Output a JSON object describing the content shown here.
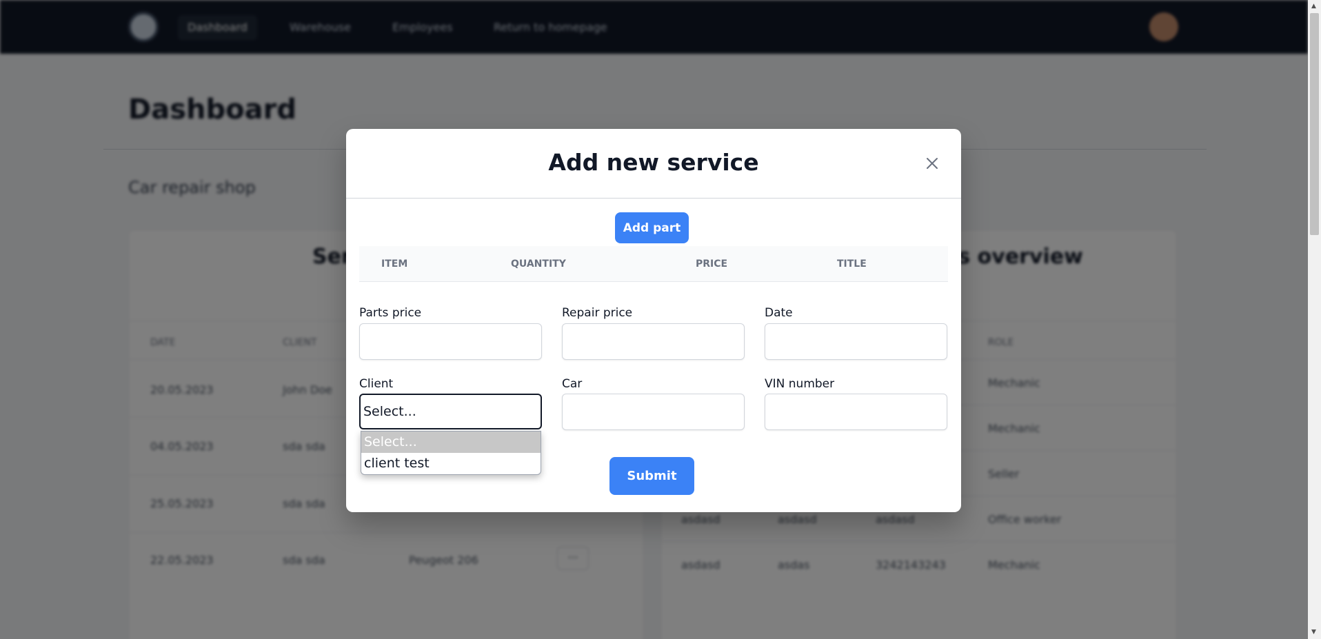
{
  "navbar": {
    "links": [
      "Dashboard",
      "Warehouse",
      "Employees",
      "Return to homepage"
    ]
  },
  "page": {
    "title": "Dashboard",
    "subtitle": "Car repair shop"
  },
  "services_card": {
    "heading": "Services",
    "columns": [
      "DATE",
      "CLIENT"
    ],
    "rows": [
      {
        "date": "20.05.2023",
        "client": "John Doe",
        "car": ""
      },
      {
        "date": "04.05.2023",
        "client": "sda sda",
        "car": ""
      },
      {
        "date": "25.05.2023",
        "client": "sda sda",
        "car": ""
      },
      {
        "date": "22.05.2023",
        "client": "sda sda",
        "car": "Peugeot 206"
      }
    ],
    "row_action": "···"
  },
  "employees_card": {
    "heading": "Employees overview",
    "columns": [
      "",
      "",
      "",
      "ROLE"
    ],
    "rows": [
      {
        "c1": "",
        "c2": "",
        "c3": "",
        "role": "Mechanic"
      },
      {
        "c1": "",
        "c2": "",
        "c3": "",
        "role": "Mechanic"
      },
      {
        "c1": "",
        "c2": "",
        "c3": "",
        "role": "Seller"
      },
      {
        "c1": "asdasd",
        "c2": "asdasd",
        "c3": "asdasd",
        "role": "Office worker"
      },
      {
        "c1": "asdasd",
        "c2": "asdas",
        "c3": "3242143243",
        "role": "Mechanic"
      }
    ]
  },
  "modal": {
    "title": "Add new service",
    "close_icon": "close-icon",
    "add_part_label": "Add part",
    "parts_table": {
      "columns": [
        "ITEM",
        "QUANTITY",
        "PRICE",
        "TITLE"
      ]
    },
    "fields": {
      "parts_price": {
        "label": "Parts price",
        "value": ""
      },
      "repair_price": {
        "label": "Repair price",
        "value": ""
      },
      "date": {
        "label": "Date",
        "value": ""
      },
      "client": {
        "label": "Client",
        "value": "Select..."
      },
      "car": {
        "label": "Car",
        "value": ""
      },
      "vin": {
        "label": "VIN number",
        "value": ""
      }
    },
    "client_options": [
      "Select...",
      "client test"
    ],
    "submit_label": "Submit"
  },
  "colors": {
    "primary": "#3b82f6",
    "navbar": "#111827",
    "overlay": "rgba(0,0,0,0.5)"
  }
}
